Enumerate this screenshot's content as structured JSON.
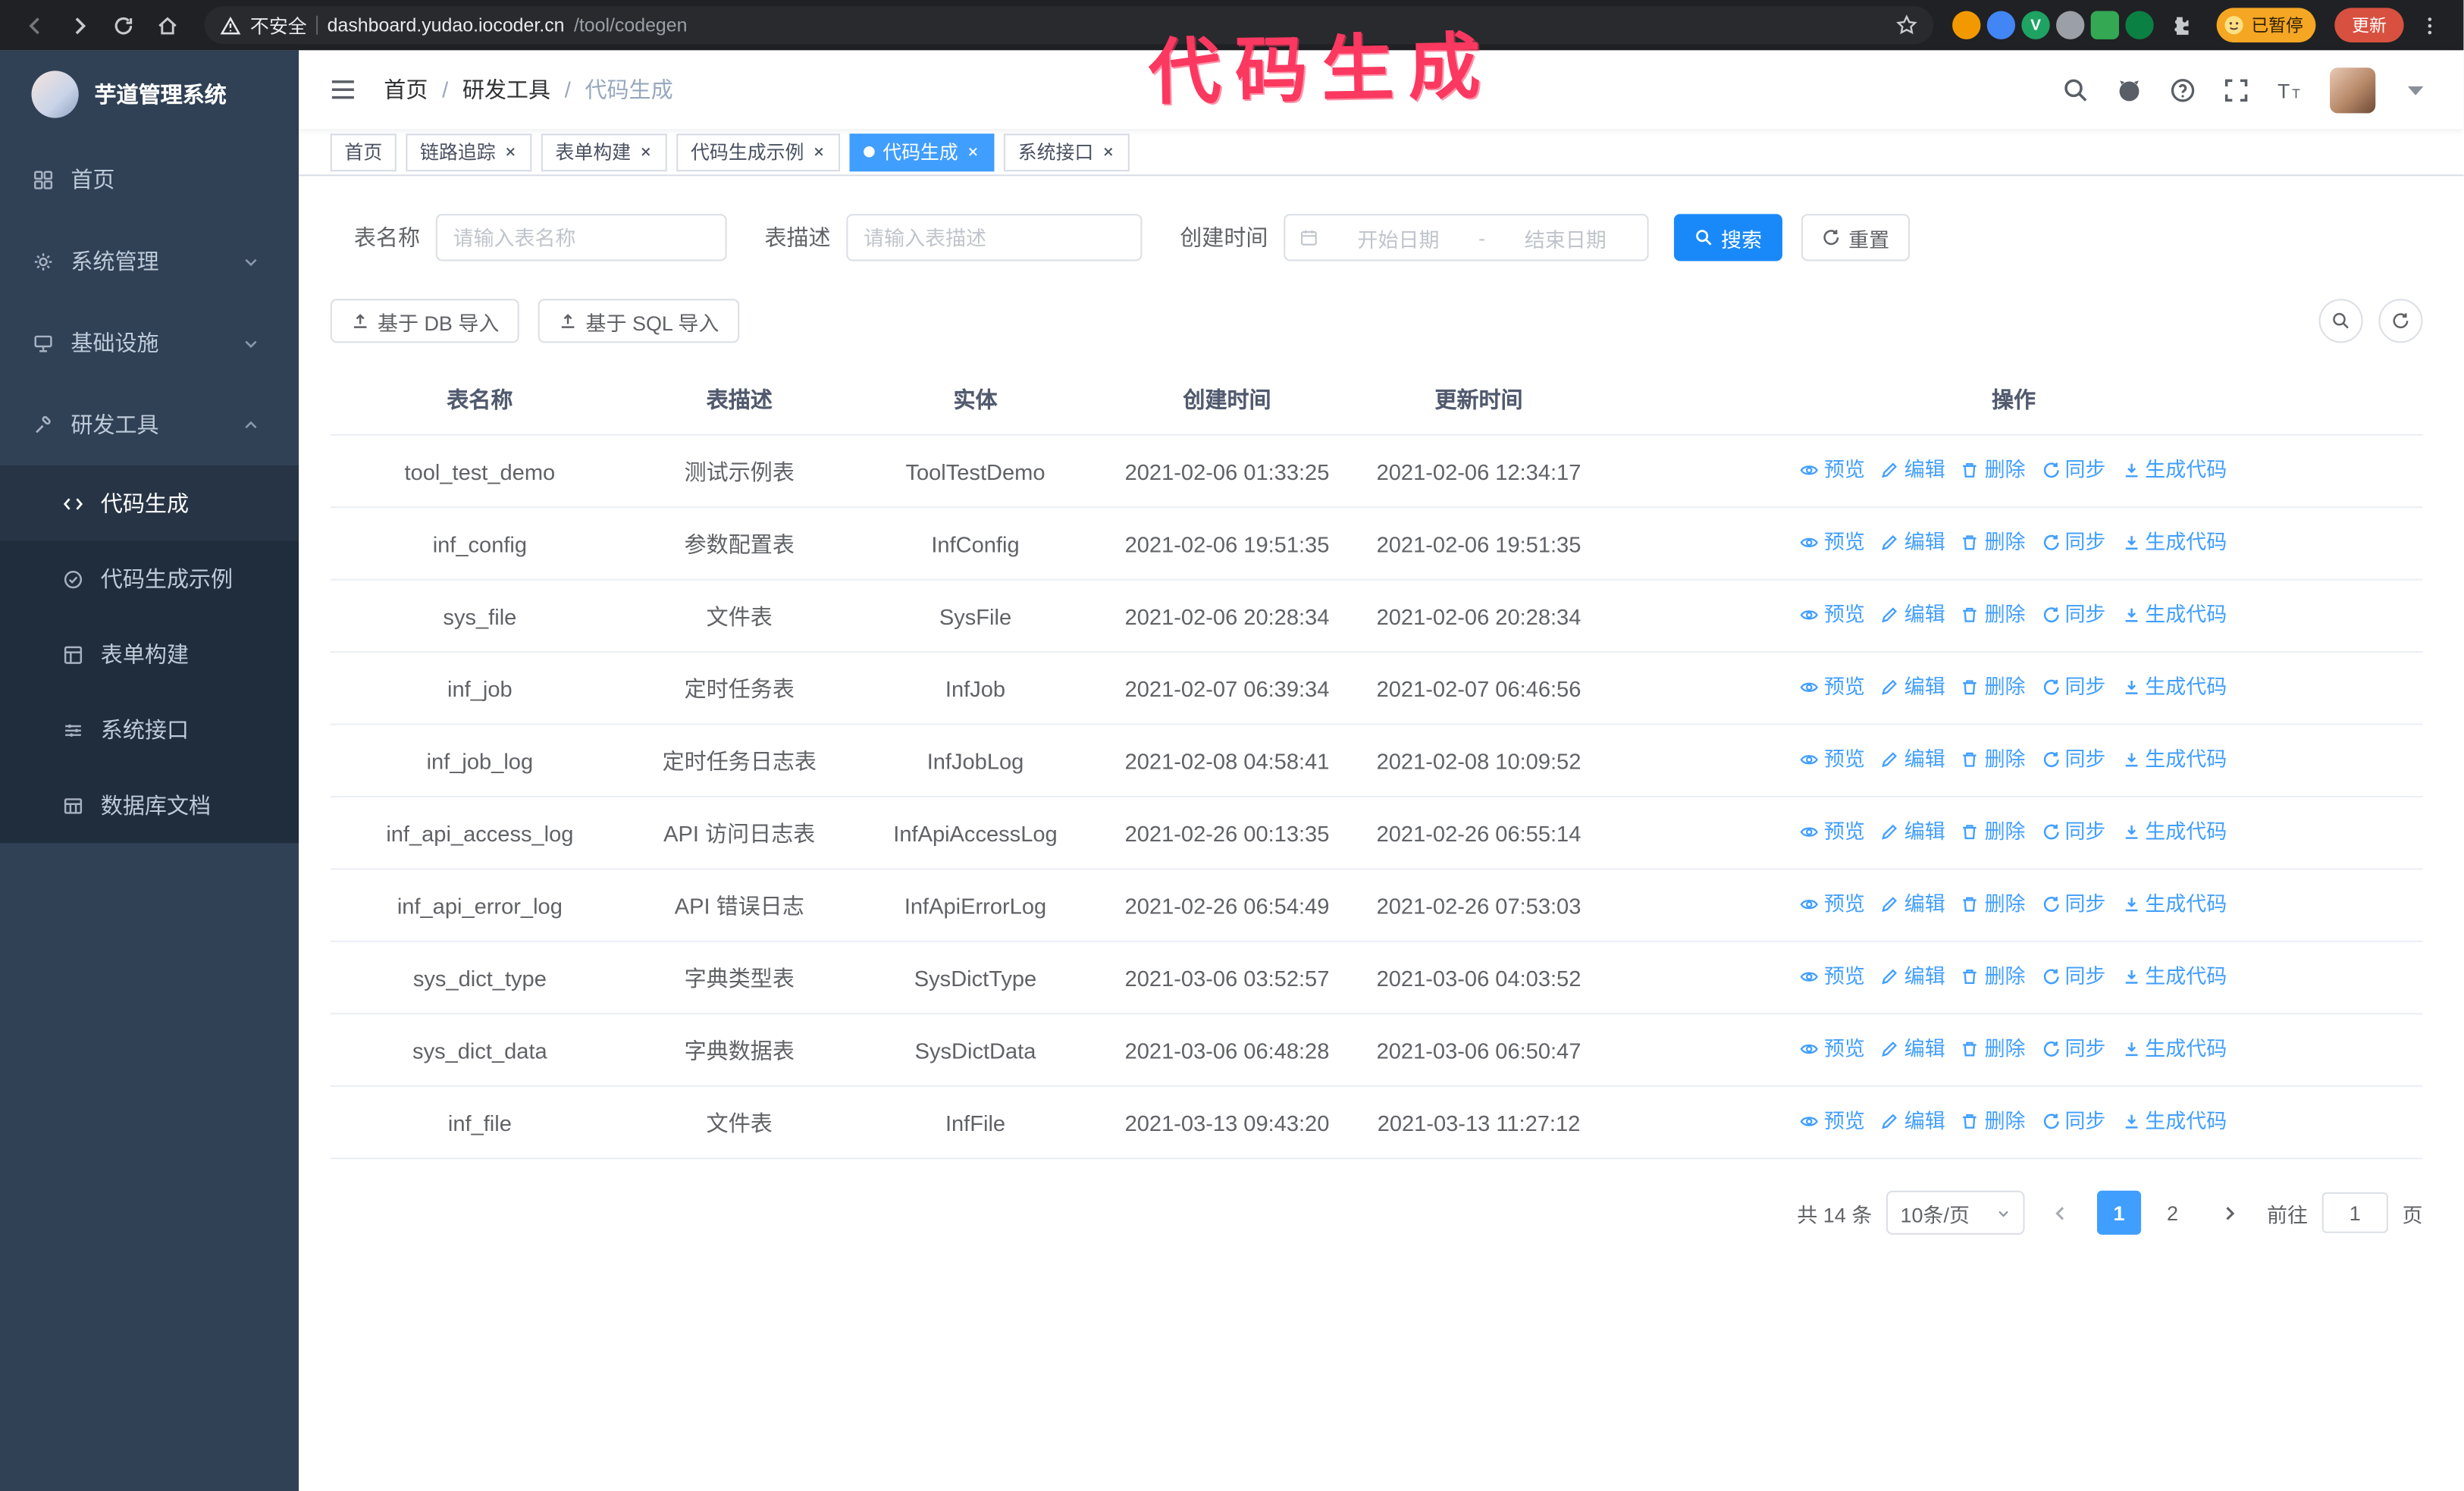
{
  "annotation": {
    "text": "代码生成"
  },
  "browser": {
    "security_label": "不安全",
    "url_host": "dashboard.yudao.iocoder.cn",
    "url_path": "/tool/codegen",
    "profile_badge": "已暂停",
    "update_label": "更新"
  },
  "sidebar": {
    "app_title": "芋道管理系统",
    "items": [
      {
        "label": "首页",
        "icon": "dashboard-icon",
        "expandable": false,
        "expanded": false
      },
      {
        "label": "系统管理",
        "icon": "gear-icon",
        "expandable": true,
        "expanded": false
      },
      {
        "label": "基础设施",
        "icon": "infra-icon",
        "expandable": true,
        "expanded": false
      },
      {
        "label": "研发工具",
        "icon": "tools-icon",
        "expandable": true,
        "expanded": true
      }
    ],
    "submenu": [
      {
        "label": "代码生成",
        "icon": "code-icon",
        "active": true
      },
      {
        "label": "代码生成示例",
        "icon": "badge-icon",
        "active": false
      },
      {
        "label": "表单构建",
        "icon": "form-icon",
        "active": false
      },
      {
        "label": "系统接口",
        "icon": "api-icon",
        "active": false
      },
      {
        "label": "数据库文档",
        "icon": "database-icon",
        "active": false
      }
    ]
  },
  "navbar": {
    "breadcrumb": [
      "首页",
      "研发工具",
      "代码生成"
    ]
  },
  "tabs": [
    {
      "label": "首页",
      "closable": false,
      "active": false
    },
    {
      "label": "链路追踪",
      "closable": true,
      "active": false
    },
    {
      "label": "表单构建",
      "closable": true,
      "active": false
    },
    {
      "label": "代码生成示例",
      "closable": true,
      "active": false
    },
    {
      "label": "代码生成",
      "closable": true,
      "active": true
    },
    {
      "label": "系统接口",
      "closable": true,
      "active": false
    }
  ],
  "filters": {
    "name_label": "表名称",
    "name_placeholder": "请输入表名称",
    "desc_label": "表描述",
    "desc_placeholder": "请输入表描述",
    "time_label": "创建时间",
    "start_placeholder": "开始日期",
    "range_separator": "-",
    "end_placeholder": "结束日期",
    "search_button": "搜索",
    "reset_button": "重置"
  },
  "toolbar": {
    "import_db_label": "基于 DB 导入",
    "import_sql_label": "基于 SQL 导入"
  },
  "table": {
    "columns": [
      "表名称",
      "表描述",
      "实体",
      "创建时间",
      "更新时间",
      "操作"
    ],
    "row_actions": [
      {
        "label": "预览",
        "icon": "eye-icon"
      },
      {
        "label": "编辑",
        "icon": "edit-icon"
      },
      {
        "label": "删除",
        "icon": "delete-icon"
      },
      {
        "label": "同步",
        "icon": "sync-icon"
      },
      {
        "label": "生成代码",
        "icon": "download-icon"
      }
    ],
    "rows": [
      {
        "name": "tool_test_demo",
        "desc": "测试示例表",
        "entity": "ToolTestDemo",
        "created": "2021-02-06 01:33:25",
        "updated": "2021-02-06 12:34:17"
      },
      {
        "name": "inf_config",
        "desc": "参数配置表",
        "entity": "InfConfig",
        "created": "2021-02-06 19:51:35",
        "updated": "2021-02-06 19:51:35"
      },
      {
        "name": "sys_file",
        "desc": "文件表",
        "entity": "SysFile",
        "created": "2021-02-06 20:28:34",
        "updated": "2021-02-06 20:28:34"
      },
      {
        "name": "inf_job",
        "desc": "定时任务表",
        "entity": "InfJob",
        "created": "2021-02-07 06:39:34",
        "updated": "2021-02-07 06:46:56"
      },
      {
        "name": "inf_job_log",
        "desc": "定时任务日志表",
        "entity": "InfJobLog",
        "created": "2021-02-08 04:58:41",
        "updated": "2021-02-08 10:09:52"
      },
      {
        "name": "inf_api_access_log",
        "desc": "API 访问日志表",
        "entity": "InfApiAccessLog",
        "created": "2021-02-26 00:13:35",
        "updated": "2021-02-26 06:55:14"
      },
      {
        "name": "inf_api_error_log",
        "desc": "API 错误日志",
        "entity": "InfApiErrorLog",
        "created": "2021-02-26 06:54:49",
        "updated": "2021-02-26 07:53:03"
      },
      {
        "name": "sys_dict_type",
        "desc": "字典类型表",
        "entity": "SysDictType",
        "created": "2021-03-06 03:52:57",
        "updated": "2021-03-06 04:03:52"
      },
      {
        "name": "sys_dict_data",
        "desc": "字典数据表",
        "entity": "SysDictData",
        "created": "2021-03-06 06:48:28",
        "updated": "2021-03-06 06:50:47"
      },
      {
        "name": "inf_file",
        "desc": "文件表",
        "entity": "InfFile",
        "created": "2021-03-13 09:43:20",
        "updated": "2021-03-13 11:27:12"
      }
    ]
  },
  "pagination": {
    "total_label": "共 14 条",
    "page_size": "10条/页",
    "pages": [
      "1",
      "2"
    ],
    "active_page": "1",
    "goto_label": "前往",
    "goto_value": "1",
    "page_label": "页"
  },
  "colors": {
    "accent": "#409EFF",
    "sidebar_bg": "#304156",
    "submenu_bg": "#1f2d3d",
    "annotation": "#fb3860"
  }
}
